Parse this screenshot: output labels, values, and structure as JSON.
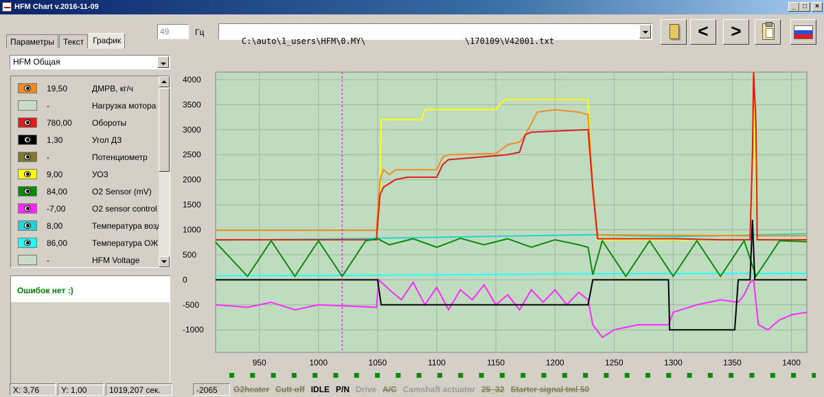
{
  "window": {
    "title": "HFM Chart  v.2016-11-09"
  },
  "tabs": [
    {
      "label": "Параметры",
      "active": false
    },
    {
      "label": "Текст",
      "active": false
    },
    {
      "label": "График",
      "active": true
    }
  ],
  "toolbar": {
    "frequency_value": "49",
    "frequency_unit": "Гц",
    "file_path": "C:\\auto\\1_users\\HFM\\0.MY\\                    \\170109\\V42001.txt",
    "prev_symbol": "<",
    "next_symbol": ">",
    "flag_colors": [
      "#ffffff",
      "#2b4fd8",
      "#e01c1c"
    ]
  },
  "preset": "HFM Общая",
  "channels": [
    {
      "value": "19,50",
      "name": "ДМРВ, кг/ч",
      "color": "#f08c1e",
      "visible": true
    },
    {
      "value": "-",
      "name": "Нагрузка мотора",
      "color": "#c8dcc8",
      "visible": false
    },
    {
      "value": "780,00",
      "name": "Обороты",
      "color": "#e01c1c",
      "visible": true
    },
    {
      "value": "1,30",
      "name": "Угол ДЗ",
      "color": "#000000",
      "visible": true
    },
    {
      "value": "-",
      "name": "Потенциометр",
      "color": "#807a2a",
      "visible": true
    },
    {
      "value": "9,00",
      "name": "УОЗ",
      "color": "#ffff00",
      "visible": true
    },
    {
      "value": "84,00",
      "name": "O2 Sensor (mV)",
      "color": "#0a8a0a",
      "visible": true
    },
    {
      "value": "-7,00",
      "name": "O2 sensor control",
      "color": "#ff28ff",
      "visible": true
    },
    {
      "value": "8,00",
      "name": "Температура воздуха",
      "color": "#22d4d4",
      "visible": true
    },
    {
      "value": "86,00",
      "name": "Температура ОЖ",
      "color": "#22ffff",
      "visible": true
    },
    {
      "value": "-",
      "name": "HFM Voltage",
      "color": "#c8dcc8",
      "visible": false
    }
  ],
  "errors_message": "Ошибок нет :)",
  "status": {
    "x": "X: 3,76",
    "y": "Y: 1,00",
    "time": "1019,207 сек.",
    "raw": "-2065",
    "flags": [
      {
        "label": "O2heater",
        "state": "off"
      },
      {
        "label": "Cutt off",
        "state": "off"
      },
      {
        "label": "IDLE",
        "state": "on"
      },
      {
        "label": "P/N",
        "state": "on"
      },
      {
        "label": "Drive",
        "state": "dim"
      },
      {
        "label": "A/C",
        "state": "off"
      },
      {
        "label": "Camshaft actuator",
        "state": "dim"
      },
      {
        "label": "25_32",
        "state": "off"
      },
      {
        "label": "Starter signal tml 50",
        "state": "off"
      }
    ]
  },
  "chart_data": {
    "type": "line",
    "xlim": [
      913,
      1413
    ],
    "ylim": [
      -1450,
      4150
    ],
    "x_ticks": [
      950,
      1000,
      1050,
      1100,
      1150,
      1200,
      1250,
      1300,
      1350,
      1400
    ],
    "y_ticks": [
      -1000,
      -500,
      0,
      500,
      1000,
      1500,
      2000,
      2500,
      3000,
      3500,
      4000
    ],
    "grid": true,
    "background": "#c0dcc0",
    "cursor_x": 1020,
    "series": [
      {
        "color": "#22ffff",
        "points": [
          [
            913,
            80
          ],
          [
            1050,
            90
          ],
          [
            1230,
            120
          ],
          [
            1413,
            130
          ]
        ]
      },
      {
        "color": "#22d4d4",
        "points": [
          [
            913,
            790
          ],
          [
            1050,
            830
          ],
          [
            1150,
            870
          ],
          [
            1230,
            900
          ],
          [
            1300,
            860
          ],
          [
            1413,
            920
          ]
        ]
      },
      {
        "color": "#ffff00",
        "points": [
          [
            913,
            800
          ],
          [
            1049,
            800
          ],
          [
            1052,
            1600
          ],
          [
            1053,
            3200
          ],
          [
            1087,
            3200
          ],
          [
            1090,
            3400
          ],
          [
            1150,
            3400
          ],
          [
            1153,
            3500
          ],
          [
            1158,
            3600
          ],
          [
            1228,
            3600
          ],
          [
            1232,
            1800
          ],
          [
            1236,
            800
          ],
          [
            1365,
            800
          ],
          [
            1367,
            2500
          ],
          [
            1368,
            3800
          ],
          [
            1369,
            2600
          ],
          [
            1371,
            800
          ],
          [
            1413,
            800
          ]
        ]
      },
      {
        "color": "#f08c1e",
        "points": [
          [
            913,
            990
          ],
          [
            1049,
            990
          ],
          [
            1052,
            2000
          ],
          [
            1055,
            2200
          ],
          [
            1060,
            2100
          ],
          [
            1065,
            2200
          ],
          [
            1090,
            2200
          ],
          [
            1100,
            2200
          ],
          [
            1105,
            2450
          ],
          [
            1110,
            2500
          ],
          [
            1140,
            2520
          ],
          [
            1150,
            2520
          ],
          [
            1160,
            2700
          ],
          [
            1170,
            2750
          ],
          [
            1175,
            2900
          ],
          [
            1185,
            3350
          ],
          [
            1200,
            3400
          ],
          [
            1220,
            3350
          ],
          [
            1228,
            3300
          ],
          [
            1232,
            1900
          ],
          [
            1236,
            900
          ],
          [
            1365,
            880
          ],
          [
            1367,
            2500
          ],
          [
            1368,
            4150
          ],
          [
            1370,
            3200
          ],
          [
            1371,
            880
          ],
          [
            1413,
            880
          ]
        ]
      },
      {
        "color": "#e01c1c",
        "points": [
          [
            913,
            800
          ],
          [
            1049,
            800
          ],
          [
            1052,
            1700
          ],
          [
            1055,
            1850
          ],
          [
            1065,
            2000
          ],
          [
            1075,
            2050
          ],
          [
            1100,
            2050
          ],
          [
            1105,
            2300
          ],
          [
            1110,
            2400
          ],
          [
            1150,
            2480
          ],
          [
            1160,
            2500
          ],
          [
            1170,
            2550
          ],
          [
            1175,
            2900
          ],
          [
            1180,
            2950
          ],
          [
            1228,
            3000
          ],
          [
            1232,
            1800
          ],
          [
            1236,
            820
          ],
          [
            1300,
            820
          ],
          [
            1340,
            800
          ],
          [
            1365,
            800
          ],
          [
            1367,
            2500
          ],
          [
            1368,
            4150
          ],
          [
            1370,
            3000
          ],
          [
            1371,
            800
          ],
          [
            1413,
            800
          ]
        ]
      },
      {
        "color": "#0a8a0a",
        "points": [
          [
            913,
            750
          ],
          [
            940,
            70
          ],
          [
            960,
            780
          ],
          [
            980,
            70
          ],
          [
            1000,
            780
          ],
          [
            1020,
            70
          ],
          [
            1040,
            780
          ],
          [
            1050,
            820
          ],
          [
            1060,
            700
          ],
          [
            1080,
            820
          ],
          [
            1100,
            650
          ],
          [
            1120,
            830
          ],
          [
            1140,
            700
          ],
          [
            1160,
            820
          ],
          [
            1180,
            650
          ],
          [
            1200,
            800
          ],
          [
            1220,
            700
          ],
          [
            1228,
            650
          ],
          [
            1232,
            100
          ],
          [
            1240,
            780
          ],
          [
            1260,
            70
          ],
          [
            1280,
            780
          ],
          [
            1300,
            70
          ],
          [
            1320,
            780
          ],
          [
            1340,
            70
          ],
          [
            1360,
            780
          ],
          [
            1370,
            70
          ],
          [
            1390,
            780
          ],
          [
            1413,
            760
          ]
        ]
      },
      {
        "color": "#ff28ff",
        "points": [
          [
            913,
            -500
          ],
          [
            940,
            -550
          ],
          [
            960,
            -450
          ],
          [
            980,
            -600
          ],
          [
            1000,
            -500
          ],
          [
            1049,
            -550
          ],
          [
            1051,
            0
          ],
          [
            1060,
            -200
          ],
          [
            1070,
            -400
          ],
          [
            1080,
            -50
          ],
          [
            1090,
            -500
          ],
          [
            1100,
            -150
          ],
          [
            1110,
            -600
          ],
          [
            1120,
            -200
          ],
          [
            1130,
            -400
          ],
          [
            1140,
            -100
          ],
          [
            1150,
            -500
          ],
          [
            1160,
            -300
          ],
          [
            1170,
            -600
          ],
          [
            1180,
            -200
          ],
          [
            1190,
            -450
          ],
          [
            1200,
            -200
          ],
          [
            1210,
            -500
          ],
          [
            1220,
            -250
          ],
          [
            1228,
            -400
          ],
          [
            1232,
            -900
          ],
          [
            1240,
            -1150
          ],
          [
            1250,
            -1000
          ],
          [
            1270,
            -900
          ],
          [
            1296,
            -900
          ],
          [
            1300,
            -650
          ],
          [
            1320,
            -500
          ],
          [
            1340,
            -400
          ],
          [
            1355,
            -450
          ],
          [
            1360,
            -300
          ],
          [
            1365,
            -50
          ],
          [
            1368,
            0
          ],
          [
            1372,
            -900
          ],
          [
            1380,
            -1000
          ],
          [
            1390,
            -800
          ],
          [
            1400,
            -700
          ],
          [
            1413,
            -650
          ]
        ]
      },
      {
        "color": "#000000",
        "points": [
          [
            913,
            0
          ],
          [
            1050,
            0
          ],
          [
            1053,
            -500
          ],
          [
            1228,
            -500
          ],
          [
            1232,
            0
          ],
          [
            1296,
            0
          ],
          [
            1297,
            -1000
          ],
          [
            1352,
            -1000
          ],
          [
            1355,
            0
          ],
          [
            1365,
            0
          ],
          [
            1367,
            1200
          ],
          [
            1369,
            0
          ],
          [
            1413,
            0
          ]
        ]
      }
    ]
  }
}
